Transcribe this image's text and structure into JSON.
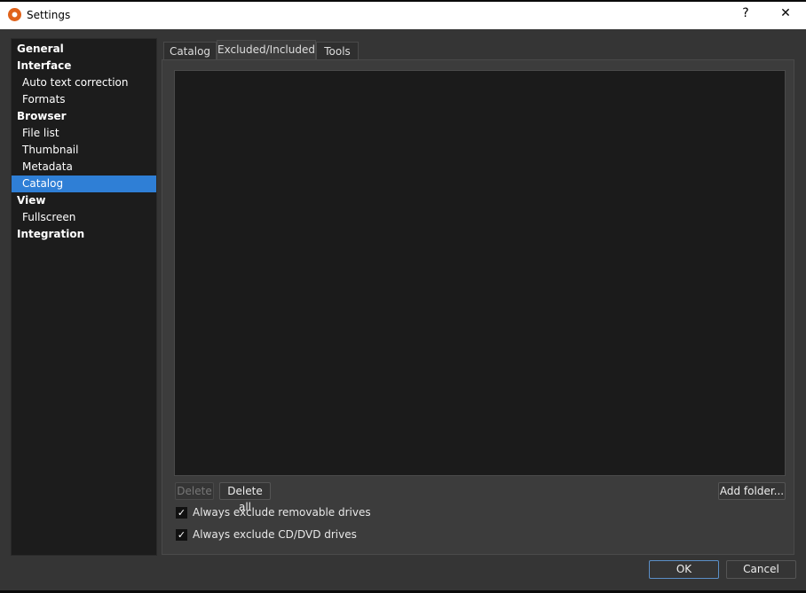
{
  "window": {
    "title": "Settings",
    "help": "?",
    "close": "✕"
  },
  "sidebar": {
    "items": [
      {
        "label": "General",
        "level": 0
      },
      {
        "label": "Interface",
        "level": 0
      },
      {
        "label": "Auto text correction",
        "level": 1
      },
      {
        "label": "Formats",
        "level": 1
      },
      {
        "label": "Browser",
        "level": 0
      },
      {
        "label": "File list",
        "level": 1
      },
      {
        "label": "Thumbnail",
        "level": 1
      },
      {
        "label": "Metadata",
        "level": 1
      },
      {
        "label": "Catalog",
        "level": 1,
        "selected": true
      },
      {
        "label": "View",
        "level": 0
      },
      {
        "label": "Fullscreen",
        "level": 1
      },
      {
        "label": "Integration",
        "level": 0
      }
    ]
  },
  "tabs": [
    "Catalog",
    "Excluded/Included",
    "Tools"
  ],
  "active_tab": "Excluded/Included",
  "buttons": {
    "delete": "Delete",
    "delete_all": "Delete all",
    "add_folder": "Add folder...",
    "ok": "OK",
    "cancel": "Cancel"
  },
  "checkboxes": [
    {
      "label": "Always exclude removable drives",
      "checked": true
    },
    {
      "label": "Always exclude CD/DVD drives",
      "checked": true
    }
  ],
  "check_glyph": "✓"
}
